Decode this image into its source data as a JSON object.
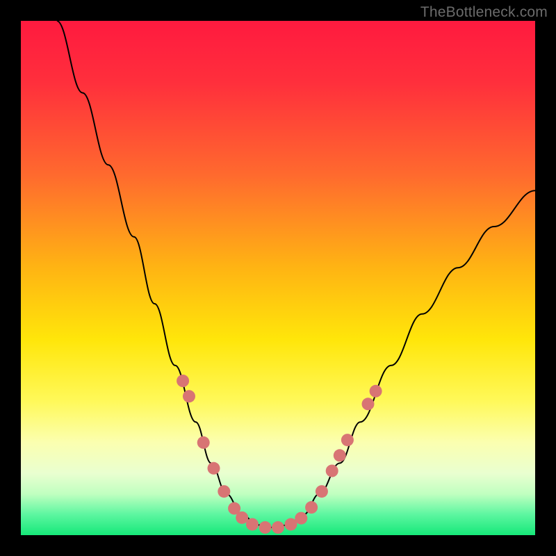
{
  "watermark": "TheBottleneck.com",
  "chart_data": {
    "type": "line",
    "title": "",
    "xlabel": "",
    "ylabel": "",
    "xlim": [
      0,
      100
    ],
    "ylim": [
      0,
      100
    ],
    "grid": false,
    "legend": false,
    "gradient_stops": [
      {
        "offset": 0.0,
        "color": "#ff1a3f"
      },
      {
        "offset": 0.12,
        "color": "#ff2f3c"
      },
      {
        "offset": 0.3,
        "color": "#ff6a2e"
      },
      {
        "offset": 0.48,
        "color": "#ffb413"
      },
      {
        "offset": 0.62,
        "color": "#ffe60a"
      },
      {
        "offset": 0.74,
        "color": "#fff95a"
      },
      {
        "offset": 0.82,
        "color": "#fbffb0"
      },
      {
        "offset": 0.88,
        "color": "#e9ffd0"
      },
      {
        "offset": 0.92,
        "color": "#c0ffc0"
      },
      {
        "offset": 0.96,
        "color": "#5cf6a0"
      },
      {
        "offset": 1.0,
        "color": "#16e879"
      }
    ],
    "series": [
      {
        "name": "bottleneck-curve",
        "color": "#000000",
        "stroke_width": 2,
        "points_xy": [
          [
            7,
            100
          ],
          [
            12,
            86
          ],
          [
            17,
            72
          ],
          [
            22,
            58
          ],
          [
            26,
            45
          ],
          [
            30,
            33
          ],
          [
            34,
            22
          ],
          [
            37,
            14
          ],
          [
            40,
            8
          ],
          [
            43,
            4
          ],
          [
            46,
            2
          ],
          [
            49,
            1.5
          ],
          [
            52,
            2
          ],
          [
            55,
            4
          ],
          [
            58,
            8
          ],
          [
            62,
            14
          ],
          [
            66,
            22
          ],
          [
            72,
            33
          ],
          [
            78,
            43
          ],
          [
            85,
            52
          ],
          [
            92,
            60
          ],
          [
            100,
            67
          ]
        ]
      }
    ],
    "markers": {
      "name": "highlight-dots",
      "color": "#d87474",
      "radius": 9,
      "points_xy": [
        [
          31.5,
          30
        ],
        [
          32.7,
          27
        ],
        [
          35.5,
          18
        ],
        [
          37.5,
          13
        ],
        [
          39.5,
          8.5
        ],
        [
          41.5,
          5.2
        ],
        [
          43.0,
          3.4
        ],
        [
          45.0,
          2.1
        ],
        [
          47.5,
          1.5
        ],
        [
          50.0,
          1.5
        ],
        [
          52.5,
          2.1
        ],
        [
          54.5,
          3.3
        ],
        [
          56.5,
          5.4
        ],
        [
          58.5,
          8.5
        ],
        [
          60.5,
          12.5
        ],
        [
          62.0,
          15.5
        ],
        [
          63.5,
          18.5
        ],
        [
          67.5,
          25.5
        ],
        [
          69.0,
          28.0
        ]
      ]
    }
  }
}
